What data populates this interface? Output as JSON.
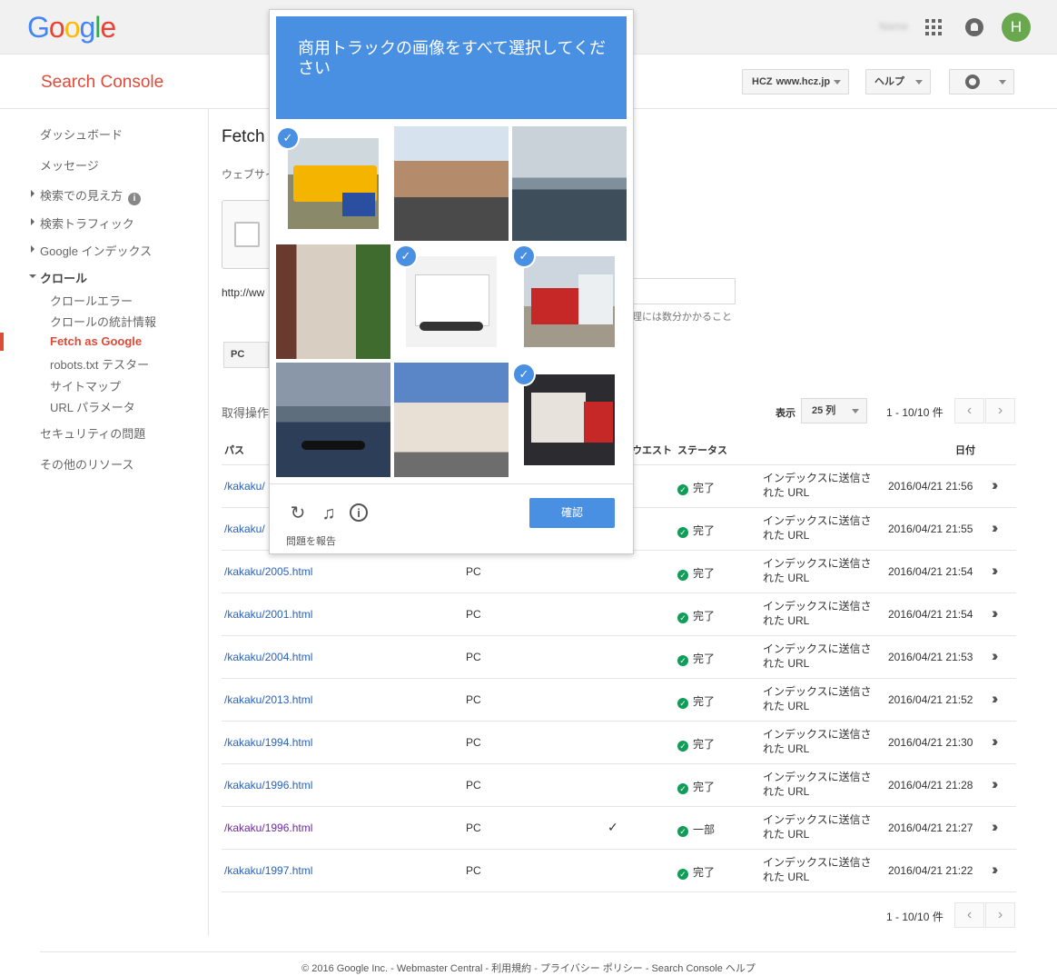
{
  "topbar": {
    "logo_letters": [
      {
        "ch": "G",
        "color": "#4285f4"
      },
      {
        "ch": "o",
        "color": "#ea4335"
      },
      {
        "ch": "o",
        "color": "#fbbc05"
      },
      {
        "ch": "g",
        "color": "#4285f4"
      },
      {
        "ch": "l",
        "color": "#34a853"
      },
      {
        "ch": "e",
        "color": "#ea4335"
      }
    ],
    "user_name": "Name",
    "avatar_letter": "H"
  },
  "header": {
    "app_title": "Search Console",
    "site": "www.hcz.jp",
    "site_logo": "HCZ",
    "help_label": "ヘルプ"
  },
  "sidebar": {
    "dashboard": "ダッシュボード",
    "messages": "メッセージ",
    "search_appearance": "検索での見え方",
    "search_traffic": "検索トラフィック",
    "google_index": "Google インデックス",
    "crawl": "クロール",
    "crawl_items": [
      "クロールエラー",
      "クロールの統計情報",
      "Fetch as Google",
      "robots.txt テスター",
      "サイトマップ",
      "URL パラメータ"
    ],
    "security": "セキュリティの問題",
    "other_resources": "その他のリソース"
  },
  "main": {
    "page_title": "Fetch",
    "description": "ウェブサイ",
    "url_prefix": "http://ww",
    "url_note": "理には数分かかること",
    "device": "PC",
    "history_label": "取得操作",
    "show_label": "表示",
    "rows_per_page": "25 列",
    "pager": "1 - 10/10 件",
    "headers": {
      "path": "パス",
      "request": "ウエスト",
      "status": "ステータス",
      "date": "日付"
    },
    "rows": [
      {
        "path": "/kakaku/",
        "type": "",
        "tick": "",
        "status": "完了",
        "index": "インデックスに送信された URL",
        "date": "2016/04/21 21:56"
      },
      {
        "path": "/kakaku/",
        "type": "",
        "tick": "",
        "status": "完了",
        "index": "インデックスに送信された URL",
        "date": "2016/04/21 21:55"
      },
      {
        "path": "/kakaku/2005.html",
        "type": "PC",
        "tick": "",
        "status": "完了",
        "index": "インデックスに送信された URL",
        "date": "2016/04/21 21:54"
      },
      {
        "path": "/kakaku/2001.html",
        "type": "PC",
        "tick": "",
        "status": "完了",
        "index": "インデックスに送信された URL",
        "date": "2016/04/21 21:54"
      },
      {
        "path": "/kakaku/2004.html",
        "type": "PC",
        "tick": "",
        "status": "完了",
        "index": "インデックスに送信された URL",
        "date": "2016/04/21 21:53"
      },
      {
        "path": "/kakaku/2013.html",
        "type": "PC",
        "tick": "",
        "status": "完了",
        "index": "インデックスに送信された URL",
        "date": "2016/04/21 21:52"
      },
      {
        "path": "/kakaku/1994.html",
        "type": "PC",
        "tick": "",
        "status": "完了",
        "index": "インデックスに送信された URL",
        "date": "2016/04/21 21:30"
      },
      {
        "path": "/kakaku/1996.html",
        "type": "PC",
        "tick": "",
        "status": "完了",
        "index": "インデックスに送信された URL",
        "date": "2016/04/21 21:28"
      },
      {
        "path": "/kakaku/1996.html",
        "type": "PC",
        "tick": "✓",
        "status": "一部",
        "index": "インデックスに送信された URL",
        "date": "2016/04/21 21:27",
        "visited": true
      },
      {
        "path": "/kakaku/1997.html",
        "type": "PC",
        "tick": "",
        "status": "完了",
        "index": "インデックスに送信された URL",
        "date": "2016/04/21 21:22"
      }
    ]
  },
  "footer": {
    "text": "© 2016 Google Inc. - Webmaster Central - 利用規約 - プライバシー ポリシー - Search Console ヘルプ"
  },
  "captcha": {
    "prompt": "商用トラックの画像をすべて選択してください",
    "tiles": [
      {
        "icon": "truck-image",
        "selected": true
      },
      {
        "icon": "canal-image",
        "selected": false
      },
      {
        "icon": "sea-image",
        "selected": false
      },
      {
        "icon": "street-image",
        "selected": false
      },
      {
        "icon": "van-image",
        "selected": true
      },
      {
        "icon": "semi-truck-image",
        "selected": true
      },
      {
        "icon": "boat-image",
        "selected": false
      },
      {
        "icon": "building-image",
        "selected": false
      },
      {
        "icon": "delivery-truck-image",
        "selected": true
      }
    ],
    "report_label": "問題を報告",
    "verify_label": "確認"
  }
}
